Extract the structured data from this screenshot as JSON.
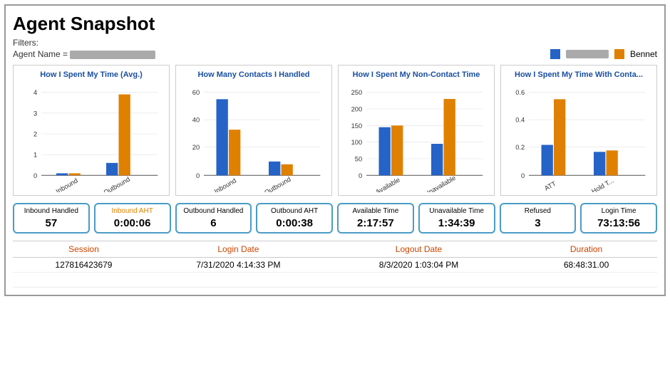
{
  "page": {
    "title": "Agent Snapshot",
    "filters_label": "Filters:",
    "agent_filter_label": "Agent Name =",
    "legend": {
      "blue_color": "#2563c7",
      "orange_color": "#e08000",
      "agent2_label": "Bennet"
    }
  },
  "charts": [
    {
      "id": "time-spent",
      "title": "How I Spent My Time (Avg.)",
      "y_max": 4,
      "y_labels": [
        "0",
        "1",
        "2",
        "3",
        "4"
      ],
      "x_labels": [
        "Inbound",
        "Outbound"
      ],
      "blue_values": [
        0.1,
        0.6
      ],
      "orange_values": [
        0.1,
        3.9
      ]
    },
    {
      "id": "contacts-handled",
      "title": "How Many Contacts I Handled",
      "y_max": 60,
      "y_labels": [
        "0",
        "20",
        "40",
        "60"
      ],
      "x_labels": [
        "Inbound",
        "Outbound"
      ],
      "blue_values": [
        55,
        10
      ],
      "orange_values": [
        33,
        8
      ]
    },
    {
      "id": "non-contact-time",
      "title": "How I Spent My Non-Contact Time",
      "y_max": 250,
      "y_labels": [
        "0",
        "50",
        "100",
        "150",
        "200",
        "250"
      ],
      "x_labels": [
        "Available",
        "Unavailable"
      ],
      "blue_values": [
        145,
        95
      ],
      "orange_values": [
        150,
        230
      ]
    },
    {
      "id": "time-with-contact",
      "title": "How I Spent My Time With Conta...",
      "y_max": 0.6,
      "y_labels": [
        "0",
        "0.2",
        "0.4",
        "0.6"
      ],
      "x_labels": [
        "ATT",
        "Hold T..."
      ],
      "blue_values": [
        0.22,
        0.17
      ],
      "orange_values": [
        0.55,
        0.18
      ]
    }
  ],
  "stats": [
    {
      "label": "Inbound Handled",
      "value": "57",
      "label_color": "blue"
    },
    {
      "label": "Inbound AHT",
      "value": "0:00:06",
      "label_color": "orange"
    },
    {
      "label": "Outbound Handled",
      "value": "6",
      "label_color": "blue"
    },
    {
      "label": "Outbound AHT",
      "value": "0:00:38",
      "label_color": "blue"
    },
    {
      "label": "Available Time",
      "value": "2:17:57",
      "label_color": "blue"
    },
    {
      "label": "Unavailable Time",
      "value": "1:34:39",
      "label_color": "blue"
    },
    {
      "label": "Refused",
      "value": "3",
      "label_color": "blue"
    },
    {
      "label": "Login Time",
      "value": "73:13:56",
      "label_color": "blue"
    }
  ],
  "table": {
    "headers": [
      "Session",
      "Login Date",
      "Logout Date",
      "Duration"
    ],
    "rows": [
      [
        "127816423679",
        "7/31/2020 4:14:33 PM",
        "8/3/2020 1:03:04 PM",
        "68:48:31.00"
      ],
      [
        "",
        "",
        "",
        ""
      ]
    ]
  }
}
